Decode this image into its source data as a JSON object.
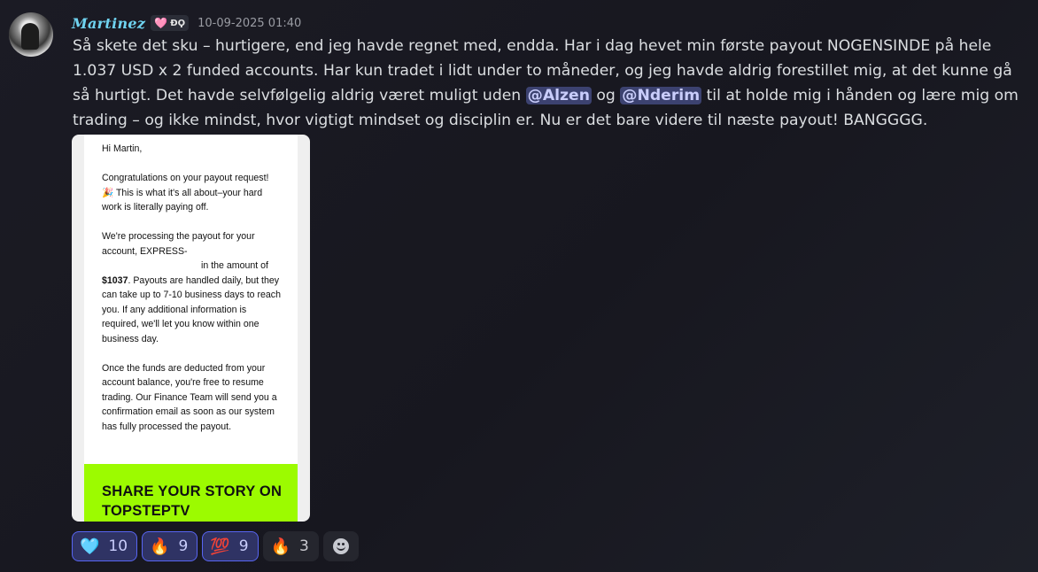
{
  "author": {
    "name": "Martinez",
    "tag_icon": "pink-heart-icon",
    "tag_icon_glyph": "🩷",
    "tag_text": "ÐϘ",
    "timestamp": "10-09-2025 01:40",
    "name_color": "#6fd3f0"
  },
  "message": {
    "text_before": "Så skete det sku – hurtigere, end jeg havde regnet med, endda. Har i dag hevet min første payout NOGENSINDE på hele 1.037 USD x 2 funded accounts. Har kun tradet i lidt under to måneder, og jeg havde aldrig forestillet mig, at det kunne gå så hurtigt. Det havde selvfølgelig aldrig været muligt uden ",
    "mention_1": "@Alzen",
    "text_between": " og ",
    "mention_2": "@Nderim",
    "text_after": " til at holde mig i hånden og lære mig om trading – og ikke mindst, hvor vigtigt mindset og disciplin er. Nu er det bare videre til næste payout! BANGGGG."
  },
  "attachment": {
    "greeting": "Hi Martin,",
    "para1_line1": "Congratulations on your payout request!",
    "para1_emoji": "🎉",
    "para1_rest": " This is what it's all about–your hard work is literally paying off.",
    "para2_line1": "We're processing the payout for your account, EXPRESS-",
    "para2_indent": "in the amount of",
    "para2_amount": "$1037",
    "para2_rest": ". Payouts are handled daily, but they can take up to 7-10 business days to reach you. If any additional information is required, we'll let you know within one business day.",
    "para3": "Once the funds are deducted from your account balance, you're free to resume trading. Our Finance Team will send you a confirmation email as soon as our system has fully processed the payout.",
    "banner_text": "SHARE YOUR STORY ON TOPSTEPTV",
    "banner_color": "#9cfb00"
  },
  "reactions": [
    {
      "icon": "blue-heart-icon",
      "glyph": "🩵",
      "count": "10",
      "active": true
    },
    {
      "icon": "fire-icon",
      "glyph": "🔥",
      "count": "9",
      "active": true
    },
    {
      "icon": "hundred-points-icon",
      "glyph": "💯",
      "count": "9",
      "active": true
    },
    {
      "icon": "fire-icon",
      "glyph": "🔥",
      "count": "3",
      "active": false
    }
  ],
  "add_reaction_icon": "smiley-icon",
  "accent_color": "#5865f2"
}
